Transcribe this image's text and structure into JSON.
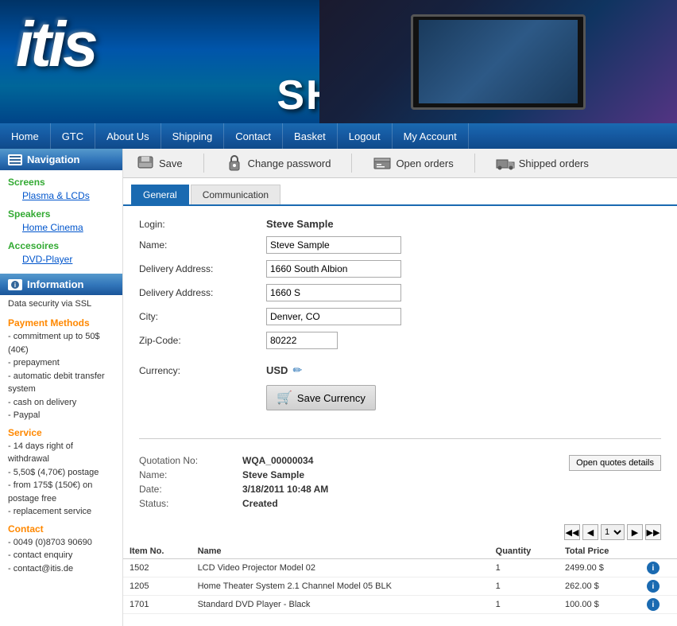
{
  "header": {
    "logo_text": "itis",
    "shop_text": "SHOP"
  },
  "navbar": {
    "items": [
      {
        "label": "Home",
        "id": "home"
      },
      {
        "label": "GTC",
        "id": "gtc"
      },
      {
        "label": "About Us",
        "id": "about"
      },
      {
        "label": "Shipping",
        "id": "shipping"
      },
      {
        "label": "Contact",
        "id": "contact"
      },
      {
        "label": "Basket",
        "id": "basket"
      },
      {
        "label": "Logout",
        "id": "logout"
      },
      {
        "label": "My Account",
        "id": "myaccount"
      }
    ]
  },
  "sidebar": {
    "nav_header": "Navigation",
    "sections": [
      {
        "label": "Screens",
        "items": [
          "Plasma & LCDs"
        ]
      },
      {
        "label": "Speakers",
        "items": [
          "Home Cinema"
        ]
      },
      {
        "label": "Accesoires",
        "items": [
          "DVD-Player"
        ]
      }
    ],
    "info_header": "Information",
    "info_text": "Data security via SSL",
    "payment_label": "Payment Methods",
    "payment_items": [
      "- commitment up to 50$ (40€)",
      "- prepayment",
      "- automatic debit transfer system",
      "- cash on delivery",
      "- Paypal"
    ],
    "service_label": "Service",
    "service_items": [
      "- 14 days right of withdrawal",
      "- 5,50$ (4,70€) postage",
      "- from 175$ (150€) on postage free",
      "- replacement service"
    ],
    "contact_label": "Contact",
    "contact_items": [
      "- 0049 (0)8703 90690",
      "- contact enquiry",
      "- contact@itis.de"
    ]
  },
  "toolbar": {
    "save_label": "Save",
    "change_password_label": "Change password",
    "open_orders_label": "Open orders",
    "shipped_orders_label": "Shipped orders"
  },
  "tabs": {
    "general_label": "General",
    "communication_label": "Communication",
    "active": "General"
  },
  "form": {
    "login_label": "Login:",
    "login_value": "Steve Sample",
    "name_label": "Name:",
    "name_value": "Steve Sample",
    "delivery_address1_label": "Delivery Address:",
    "delivery_address1_value": "1660 South Albion",
    "delivery_address2_label": "Delivery Address:",
    "delivery_address2_value": "1660 S",
    "city_label": "City:",
    "city_value": "Denver, CO",
    "zipcode_label": "Zip-Code:",
    "zipcode_value": "80222",
    "currency_label": "Currency:",
    "currency_value": "USD",
    "save_currency_label": "Save Currency"
  },
  "quotation": {
    "no_label": "Quotation No:",
    "no_value": "WQA_00000034",
    "name_label": "Name:",
    "name_value": "Steve Sample",
    "date_label": "Date:",
    "date_value": "3/18/2011 10:48 AM",
    "status_label": "Status:",
    "status_value": "Created",
    "open_quotes_btn": "Open quotes details"
  },
  "pagination": {
    "current_page": "1",
    "first_symbol": "◀◀",
    "prev_symbol": "◀",
    "next_symbol": "▶",
    "last_symbol": "▶▶"
  },
  "items_table": {
    "headers": [
      "Item No.",
      "Name",
      "Quantity",
      "Total Price",
      ""
    ],
    "rows": [
      {
        "item_no": "1502",
        "name": "LCD Video Projector Model 02",
        "quantity": "1",
        "total_price": "2499.00 $"
      },
      {
        "item_no": "1205",
        "name": "Home Theater System 2.1 Channel Model 05 BLK",
        "quantity": "1",
        "total_price": "262.00 $"
      },
      {
        "item_no": "1701",
        "name": "Standard DVD Player - Black",
        "quantity": "1",
        "total_price": "100.00 $"
      }
    ]
  }
}
